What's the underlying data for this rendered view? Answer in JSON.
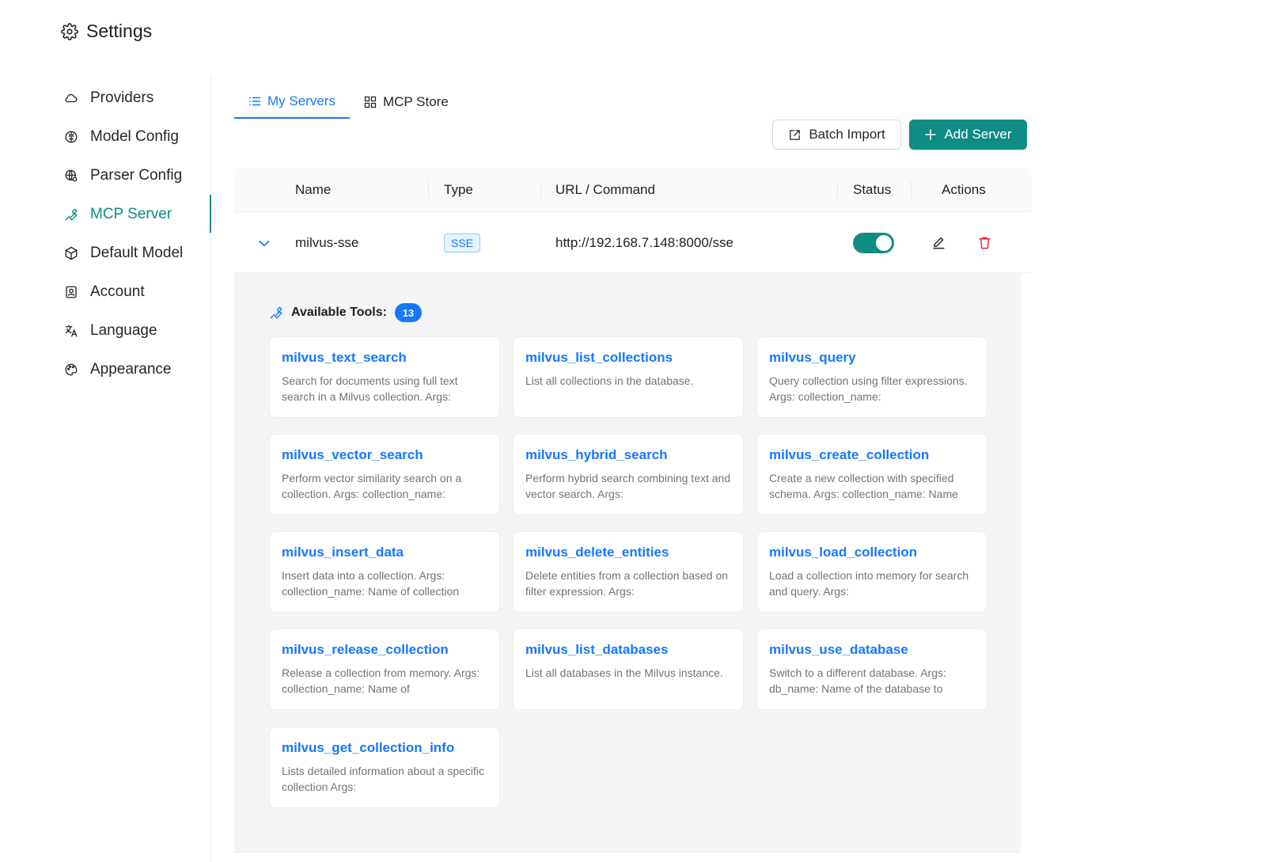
{
  "page": {
    "title": "Settings"
  },
  "sidebar": {
    "items": [
      {
        "label": "Providers",
        "icon": "cloud-icon"
      },
      {
        "label": "Model Config",
        "icon": "brain-icon"
      },
      {
        "label": "Parser Config",
        "icon": "globe-gear-icon"
      },
      {
        "label": "MCP Server",
        "icon": "tool-icon",
        "active": true
      },
      {
        "label": "Default Model",
        "icon": "cube-icon"
      },
      {
        "label": "Account",
        "icon": "user-card-icon"
      },
      {
        "label": "Language",
        "icon": "translate-icon"
      },
      {
        "label": "Appearance",
        "icon": "palette-icon"
      }
    ]
  },
  "tabs": [
    {
      "label": "My Servers",
      "icon": "list-icon",
      "active": true
    },
    {
      "label": "MCP Store",
      "icon": "grid-icon"
    }
  ],
  "toolbar": {
    "batch_import_label": "Batch Import",
    "add_server_label": "Add Server"
  },
  "table": {
    "headers": [
      "Name",
      "Type",
      "URL / Command",
      "Status",
      "Actions"
    ],
    "rows": [
      {
        "name": "milvus-sse",
        "type": "SSE",
        "url": "http://192.168.7.148:8000/sse",
        "enabled": true
      }
    ]
  },
  "tools": {
    "label": "Available Tools:",
    "count": "13",
    "items": [
      {
        "name": "milvus_text_search",
        "description": "Search for documents using full text search in a Milvus collection. Args:"
      },
      {
        "name": "milvus_list_collections",
        "description": "List all collections in the database."
      },
      {
        "name": "milvus_query",
        "description": "Query collection using filter expressions. Args: collection_name:"
      },
      {
        "name": "milvus_vector_search",
        "description": "Perform vector similarity search on a collection. Args: collection_name:"
      },
      {
        "name": "milvus_hybrid_search",
        "description": "Perform hybrid search combining text and vector search. Args:"
      },
      {
        "name": "milvus_create_collection",
        "description": "Create a new collection with specified schema. Args: collection_name: Name"
      },
      {
        "name": "milvus_insert_data",
        "description": "Insert data into a collection. Args: collection_name: Name of collection"
      },
      {
        "name": "milvus_delete_entities",
        "description": "Delete entities from a collection based on filter expression. Args:"
      },
      {
        "name": "milvus_load_collection",
        "description": "Load a collection into memory for search and query. Args:"
      },
      {
        "name": "milvus_release_collection",
        "description": "Release a collection from memory. Args: collection_name: Name of"
      },
      {
        "name": "milvus_list_databases",
        "description": "List all databases in the Milvus instance."
      },
      {
        "name": "milvus_use_database",
        "description": "Switch to a different database. Args: db_name: Name of the database to"
      },
      {
        "name": "milvus_get_collection_info",
        "description": "Lists detailed information about a specific collection Args:"
      }
    ]
  },
  "colors": {
    "accent": "#0f8c84",
    "link": "#1677ff",
    "danger": "#f5222d",
    "panel": "#f5f5f5"
  }
}
